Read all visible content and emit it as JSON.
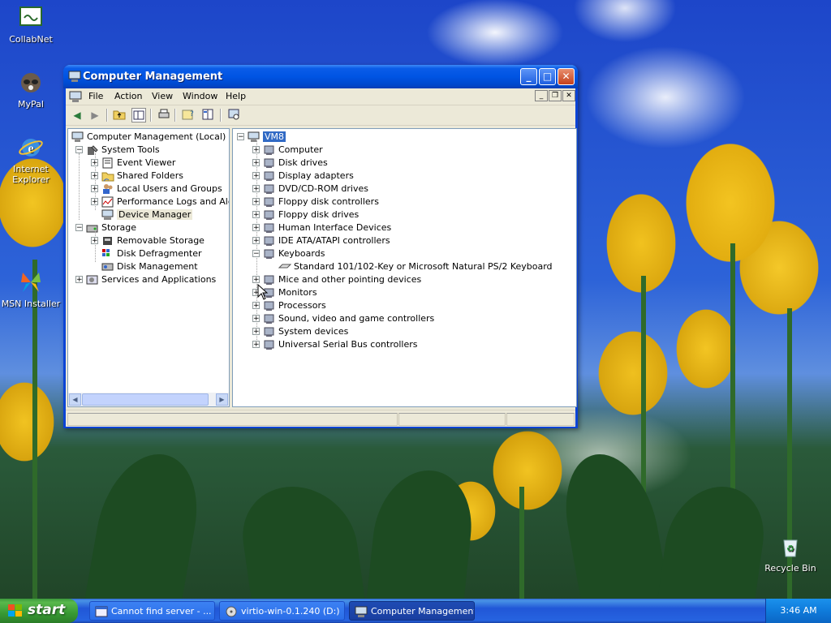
{
  "desktop": {
    "icons": [
      {
        "label": "CollabNet"
      },
      {
        "label": "MyPal"
      },
      {
        "label": "Internet Explorer"
      },
      {
        "label": "MSN Installer"
      },
      {
        "label": "Recycle Bin"
      }
    ]
  },
  "window": {
    "title": "Computer Management",
    "menu": [
      "File",
      "Action",
      "View",
      "Window",
      "Help"
    ],
    "toolbar_icons": [
      "back-icon",
      "forward-icon",
      "up-folder-icon",
      "show-hide-tree-icon",
      "print-icon",
      "help-icon",
      "properties-icon",
      "scan-hardware-icon"
    ],
    "left_tree": {
      "root": "Computer Management (Local)",
      "system_tools": "System Tools",
      "items_system": [
        "Event Viewer",
        "Shared Folders",
        "Local Users and Groups",
        "Performance Logs and Alerts",
        "Device Manager"
      ],
      "storage": "Storage",
      "items_storage": [
        "Removable Storage",
        "Disk Defragmenter",
        "Disk Management"
      ],
      "services": "Services and Applications"
    },
    "right_tree": {
      "root": "VM8",
      "items": [
        "Computer",
        "Disk drives",
        "Display adapters",
        "DVD/CD-ROM drives",
        "Floppy disk controllers",
        "Floppy disk drives",
        "Human Interface Devices",
        "IDE ATA/ATAPI controllers",
        "Keyboards"
      ],
      "keyboard_child": "Standard 101/102-Key or Microsoft Natural PS/2 Keyboard",
      "items_after": [
        "Mice and other pointing devices",
        "Monitors",
        "Processors",
        "Sound, video and game controllers",
        "System devices",
        "Universal Serial Bus controllers"
      ]
    }
  },
  "taskbar": {
    "start_label": "start",
    "tasks": [
      {
        "label": "Cannot find server - ..."
      },
      {
        "label": "virtio-win-0.1.240 (D:)"
      },
      {
        "label": "Computer Management"
      }
    ],
    "clock": "3:46 AM"
  },
  "colors": {
    "title_blue": "#0054e3",
    "start_green": "#389a33",
    "selection_blue": "#316ac5"
  }
}
